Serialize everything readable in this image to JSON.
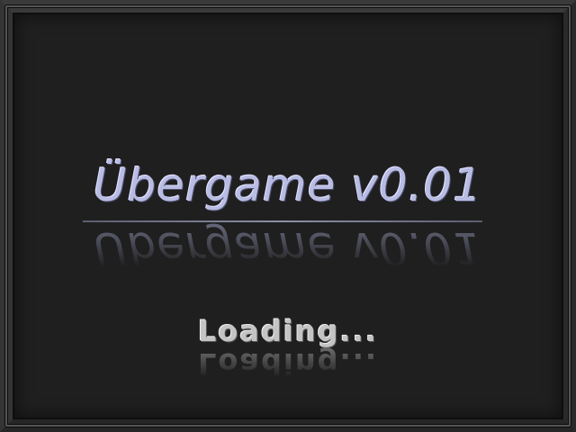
{
  "screen": {
    "title": "Übergame v0.01",
    "status": "Loading..."
  },
  "colors": {
    "background": "#1f1f1f",
    "frame": "#2e2e2e",
    "title": "#b9bce2",
    "status": "#c4c4c4"
  }
}
